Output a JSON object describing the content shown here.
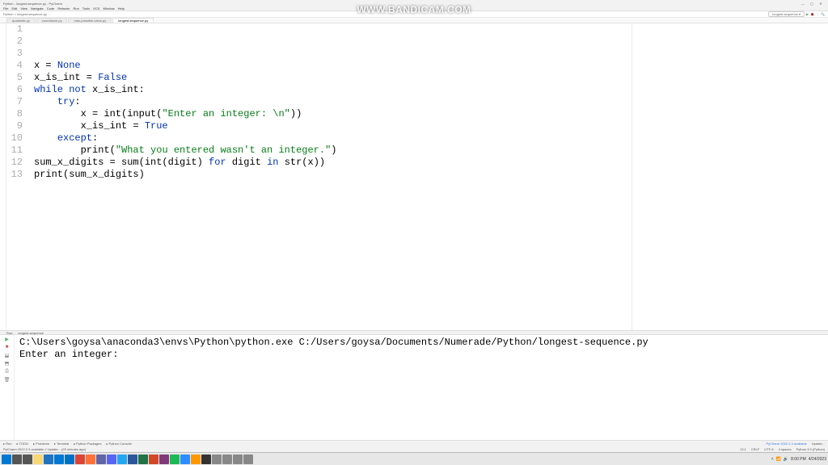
{
  "window": {
    "title": "longest-sequence.py",
    "subtitle": "Python - longest-sequence.py - PyCharm"
  },
  "menu": [
    "File",
    "Edit",
    "View",
    "Navigate",
    "Code",
    "Refactor",
    "Run",
    "Tools",
    "VCS",
    "Window",
    "Help"
  ],
  "toolbar": {
    "breadcrumb": "Python  >  longest-sequence.py",
    "run_config": "longest-sequence"
  },
  "tabs": [
    {
      "label": "quadratic.py",
      "active": false
    },
    {
      "label": "countdown.py",
      "active": false
    },
    {
      "label": "max-possible-value.py",
      "active": false
    },
    {
      "label": "longest-sequence.py",
      "active": true
    }
  ],
  "code": {
    "lines": [
      {
        "n": 1,
        "seg": [
          [
            "",
            "x = "
          ],
          [
            "kw2",
            "None"
          ]
        ]
      },
      {
        "n": 2,
        "seg": [
          [
            "",
            "x_is_int = "
          ],
          [
            "kw2",
            "False"
          ]
        ]
      },
      {
        "n": 3,
        "seg": [
          [
            "",
            ""
          ]
        ]
      },
      {
        "n": 4,
        "seg": [
          [
            "blue",
            "while "
          ],
          [
            "blue",
            "not "
          ],
          [
            "",
            "x_is_int:"
          ]
        ]
      },
      {
        "n": 5,
        "seg": [
          [
            "",
            "    "
          ],
          [
            "blue",
            "try"
          ],
          [
            "",
            ":"
          ]
        ]
      },
      {
        "n": 6,
        "seg": [
          [
            "",
            "        x = int(input("
          ],
          [
            "str",
            "\"Enter an integer: \\n\""
          ],
          [
            "",
            "))"
          ]
        ]
      },
      {
        "n": 7,
        "seg": [
          [
            "",
            "        x_is_int = "
          ],
          [
            "kw2",
            "True"
          ]
        ]
      },
      {
        "n": 8,
        "seg": [
          [
            "",
            "    "
          ],
          [
            "blue",
            "except"
          ],
          [
            "",
            ":"
          ]
        ]
      },
      {
        "n": 9,
        "seg": [
          [
            "",
            "        print("
          ],
          [
            "str",
            "\"What you entered wasn't an integer.\""
          ],
          [
            "",
            ")"
          ]
        ]
      },
      {
        "n": 10,
        "seg": [
          [
            "",
            ""
          ]
        ]
      },
      {
        "n": 11,
        "seg": [
          [
            "",
            "sum_x_digits = sum(int(digit) "
          ],
          [
            "blue",
            "for "
          ],
          [
            "",
            "digit "
          ],
          [
            "blue",
            "in "
          ],
          [
            "",
            "str(x))"
          ]
        ]
      },
      {
        "n": 12,
        "seg": [
          [
            "",
            "print(sum_x_digits)"
          ]
        ]
      },
      {
        "n": 13,
        "seg": [
          [
            "",
            ""
          ]
        ],
        "current": true
      }
    ]
  },
  "panel": {
    "label": "Run:",
    "tab": "longest-sequence"
  },
  "console": {
    "lines": [
      "C:\\Users\\goysa\\anaconda3\\envs\\Python\\python.exe C:/Users/goysa/Documents/Numerade/Python/longest-sequence.py",
      "Enter an integer: "
    ]
  },
  "status": {
    "bottom_tabs": [
      "Run",
      "TODO",
      "Problems",
      "Terminal",
      "Python Packages",
      "Python Console"
    ],
    "notice": "PyCharm 2022.2.3 available",
    "update": "Update...",
    "build_msg": "PyCharm 2022.2.3 available // Update... (29 minutes ago)",
    "right": [
      "13:1",
      "CRLF",
      "UTF-8",
      "4 spaces",
      "Python 3.9 (Python)"
    ]
  },
  "taskbar": {
    "icons": [
      "start",
      "search",
      "task",
      "files",
      "edge",
      "store",
      "mail",
      "chrome",
      "firefox",
      "teams",
      "discord",
      "code",
      "word",
      "excel",
      "powerpoint",
      "onenote",
      "spotify",
      "zoom",
      "sublime",
      "terminal",
      "misc1",
      "misc2",
      "misc3",
      "misc4"
    ],
    "time": "8:00 PM",
    "date": "4/24/2023"
  },
  "watermark": "WWW.BANDICAM.COM"
}
